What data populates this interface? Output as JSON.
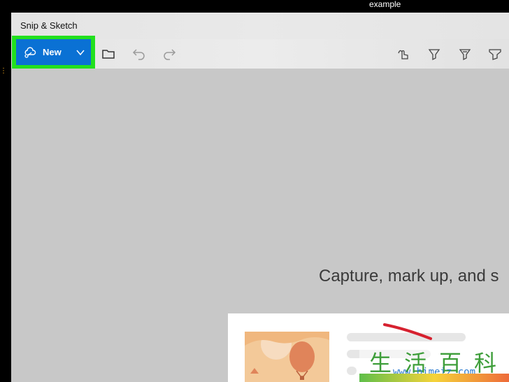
{
  "top_bar": {
    "text": "example"
  },
  "window": {
    "title": "Snip & Sketch"
  },
  "toolbar": {
    "new_label": "New",
    "icons": [
      "snip-icon",
      "chevron-down-icon",
      "folder-icon",
      "undo-icon",
      "redo-icon",
      "touch-writing-icon",
      "ballpoint-pen-icon",
      "pencil-icon",
      "highlighter-icon"
    ]
  },
  "main": {
    "capture_text": "Capture, mark up, and s"
  },
  "watermark": {
    "chars": "生活百科",
    "url": "www.bimeiz.com"
  },
  "colors": {
    "accent": "#0a71d4",
    "highlight": "#22e01e",
    "background": "#c8c8c8"
  }
}
